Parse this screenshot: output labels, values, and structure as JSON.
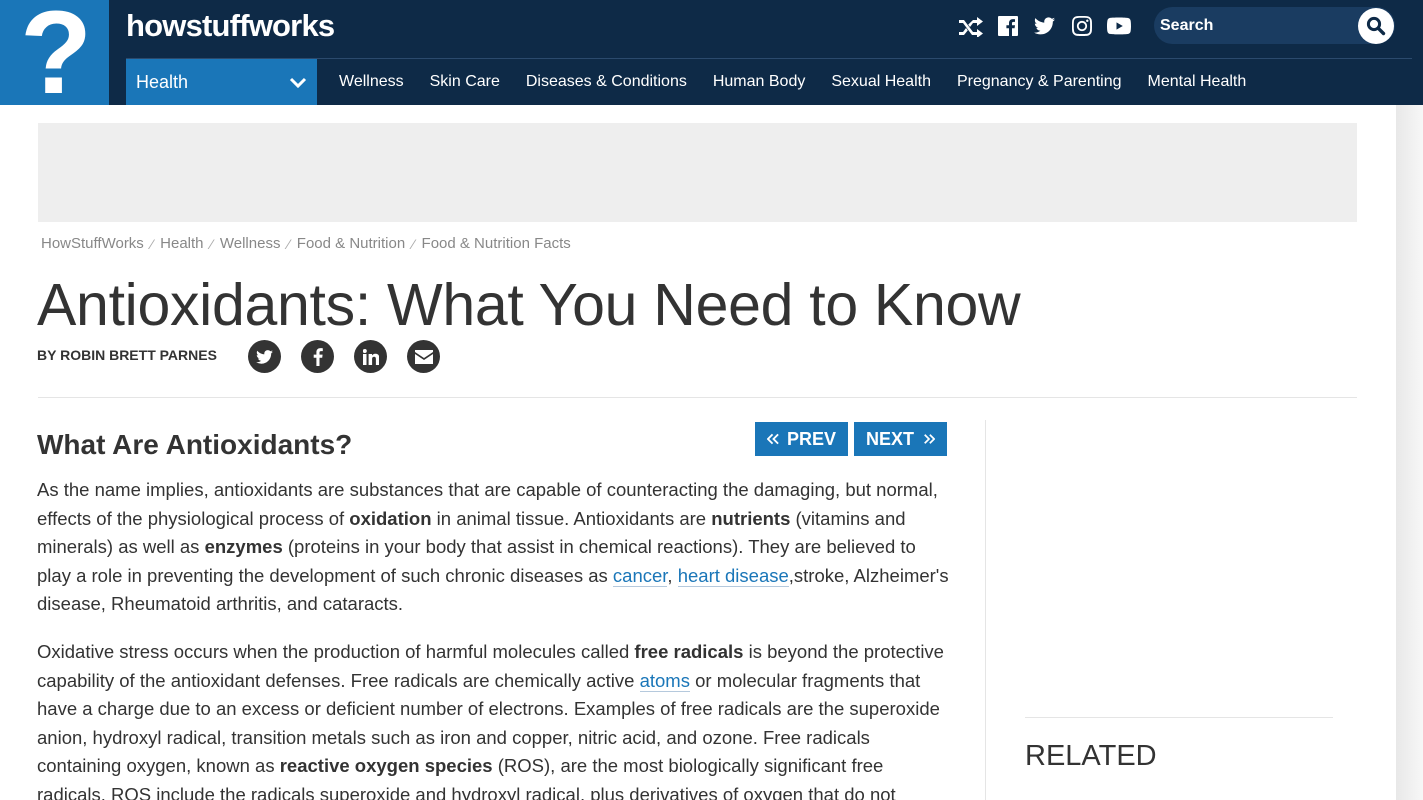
{
  "header": {
    "logo_glyph": "?",
    "site_name": "howstuffworks",
    "icons": [
      "shuffle-icon",
      "facebook-icon",
      "twitter-icon",
      "instagram-icon",
      "youtube-icon"
    ],
    "search": {
      "placeholder": "Search"
    }
  },
  "nav": {
    "channel": "Health",
    "items": [
      "Wellness",
      "Skin Care",
      "Diseases & Conditions",
      "Human Body",
      "Sexual Health",
      "Pregnancy & Parenting",
      "Mental Health"
    ]
  },
  "breadcrumb": [
    "HowStuffWorks",
    "Health",
    "Wellness",
    "Food & Nutrition",
    "Food & Nutrition Facts"
  ],
  "article": {
    "title": "Antioxidants: What You Need to Know",
    "byline": "BY ROBIN BRETT PARNES",
    "share_icons": [
      "twitter-icon",
      "facebook-icon",
      "linkedin-icon",
      "email-icon"
    ],
    "section_heading": "What Are Antioxidants?",
    "prev_label": "PREV",
    "next_label": "NEXT",
    "p1": {
      "t1": "As the name implies, antioxidants are substances that are capable of counteracting the damaging, but normal, effects of the physiological process of ",
      "b1": "oxidation",
      "t2": " in animal tissue. Antioxidants are ",
      "b2": "nutrients",
      "t3": " (vitamins and minerals) as well as ",
      "b3": "enzymes",
      "t4": " (proteins in your body that assist in chemical reactions). They are believed to play a role in preventing the development of such chronic diseases as ",
      "l1": "cancer",
      "t5": ", ",
      "l2": "heart disease",
      "t6": ",stroke, Alzheimer's disease, Rheumatoid arthritis, and cataracts."
    },
    "p2": {
      "t1": "Oxidative stress occurs when the production of harmful molecules called ",
      "b1": "free radicals",
      "t2": " is beyond the protective capability of the antioxidant defenses. Free radicals are chemically active ",
      "l1": "atoms",
      "t3": " or molecular fragments that have a charge due to an excess or deficient number of electrons. Examples of free radicals are the superoxide anion, hydroxyl radical, transition metals such as iron and copper, nitric acid, and ozone. Free radicals containing oxygen, known as ",
      "b2": "reactive oxygen species",
      "t4": " (ROS), are the most biologically significant free radicals. ROS include the radicals superoxide and hydroxyl radical, plus derivatives of oxygen that do not"
    }
  },
  "sidebar": {
    "related_heading": "RELATED"
  },
  "colors": {
    "header_bg": "#0e2a47",
    "accent_blue": "#1a76b8",
    "link_blue": "#1a76b8",
    "ad_bg": "#eeeeee"
  }
}
